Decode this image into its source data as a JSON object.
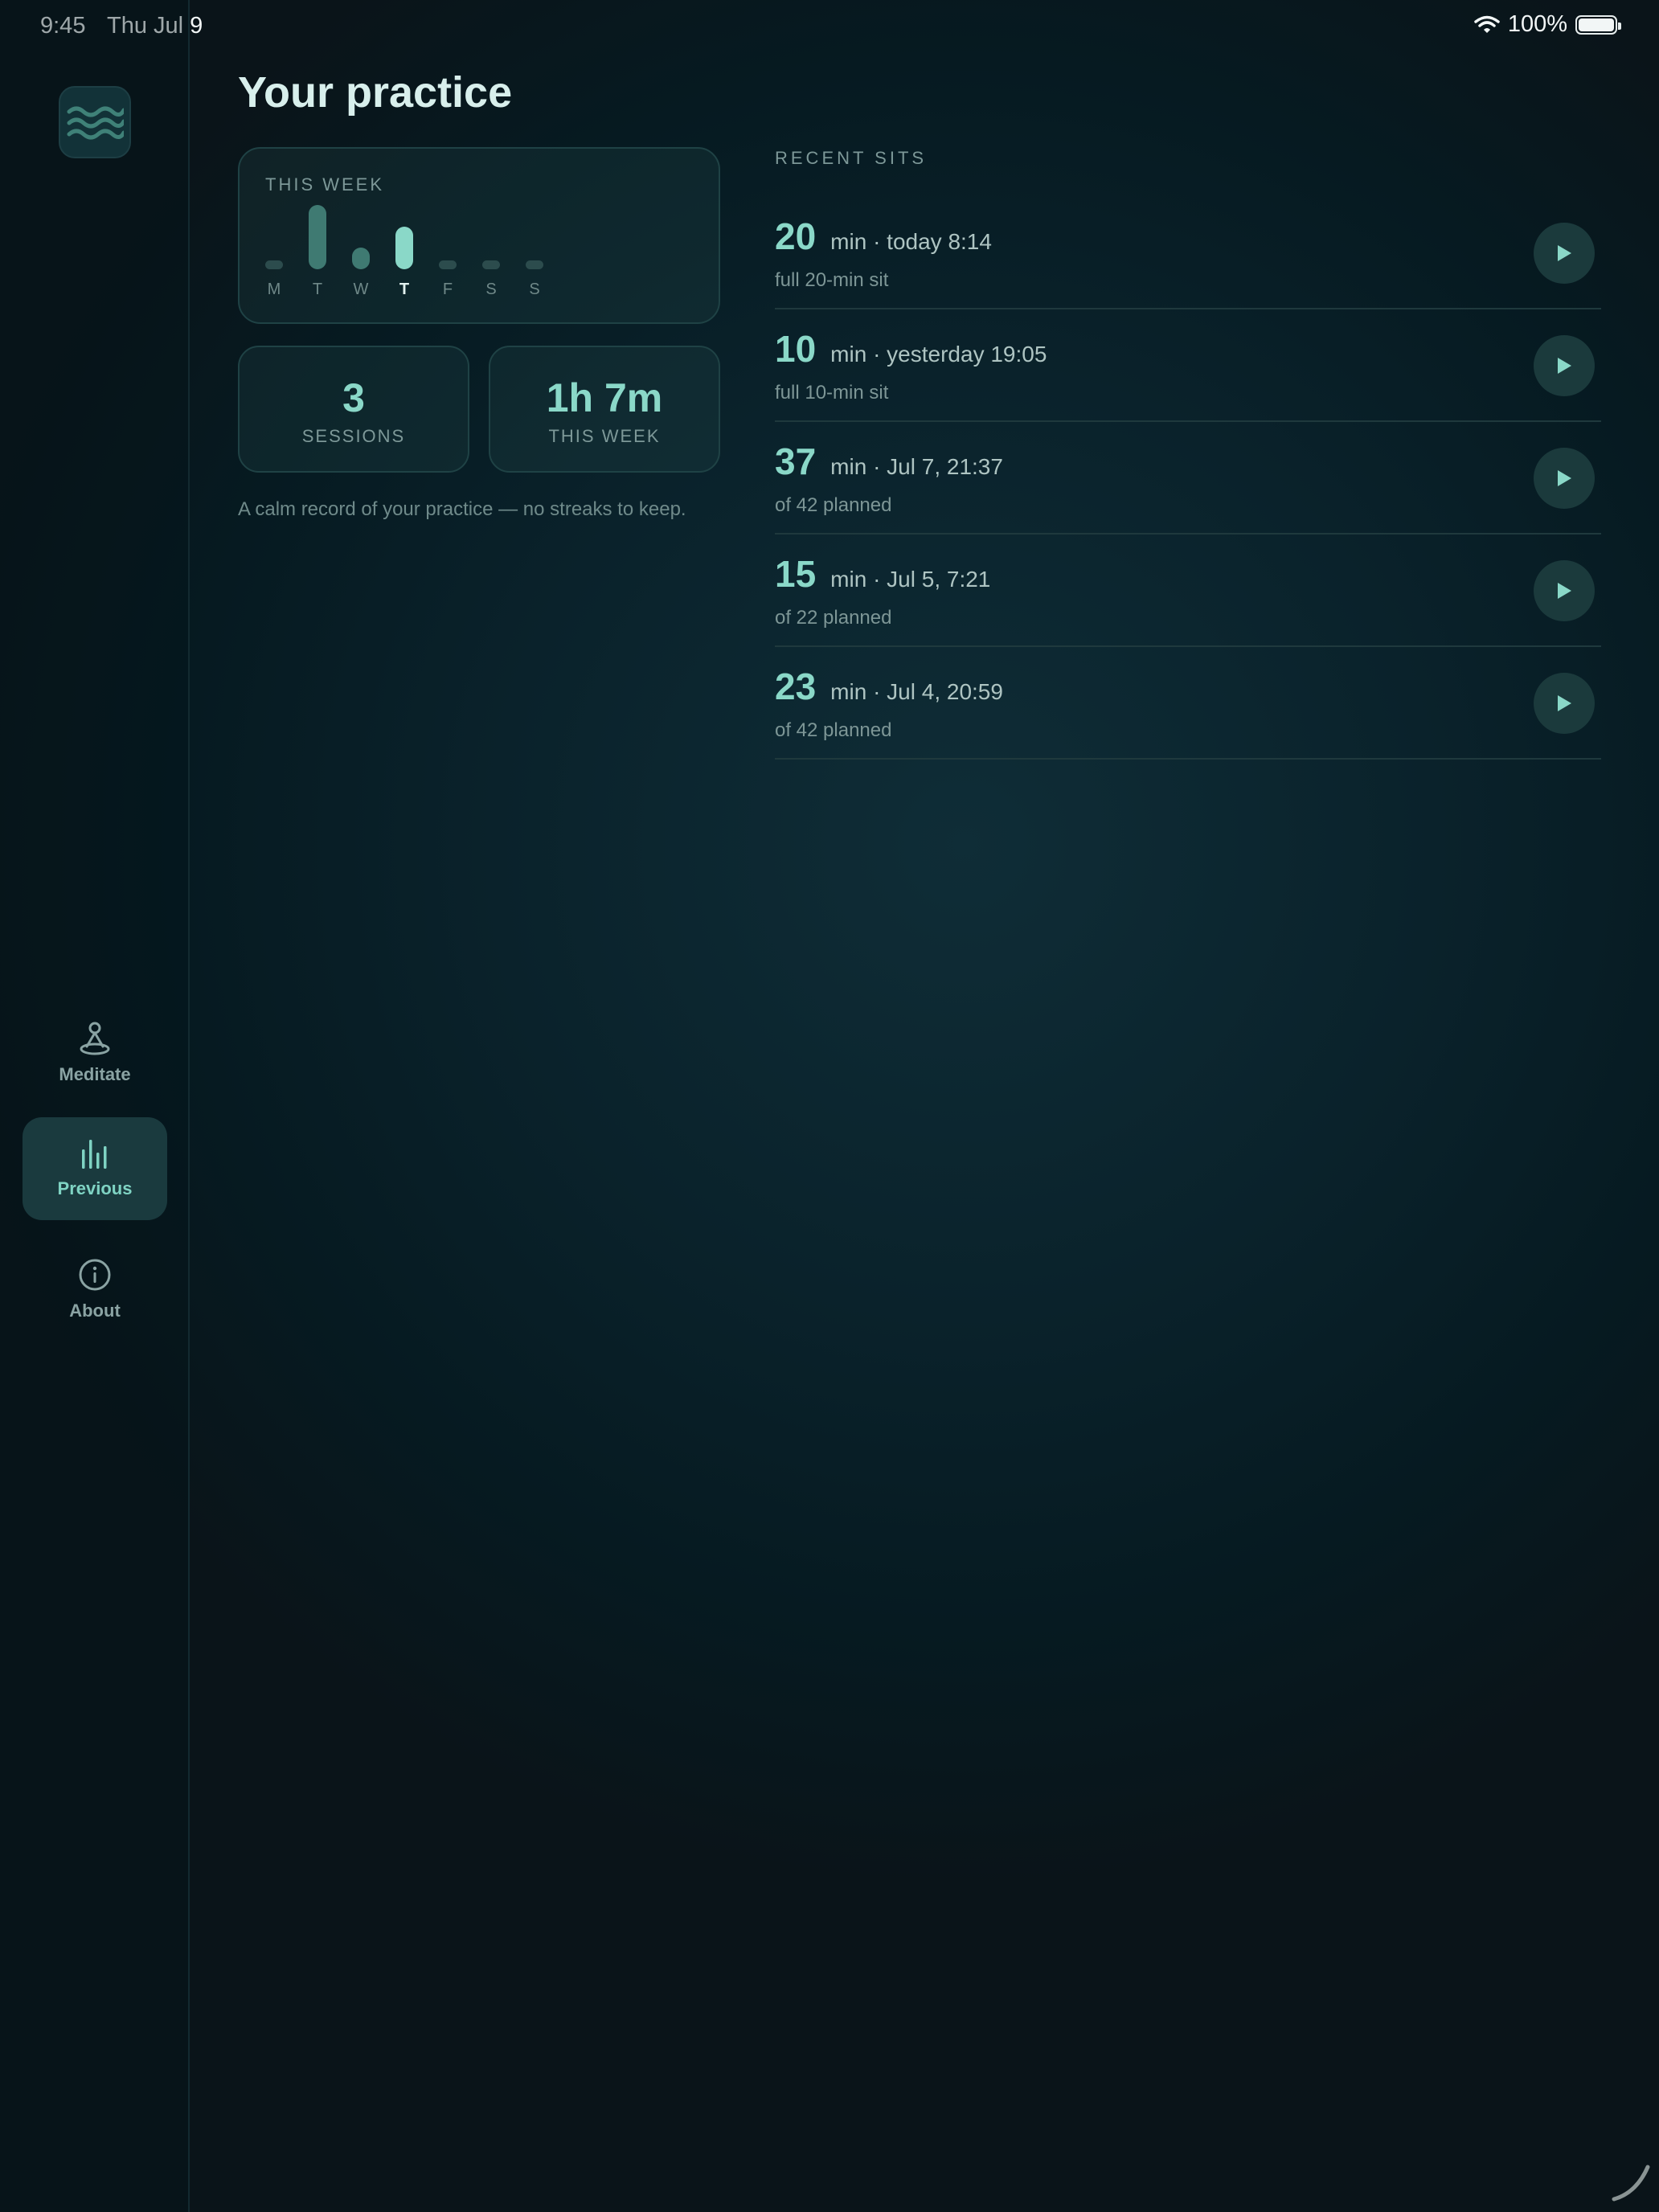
{
  "status_bar": {
    "time": "9:45",
    "date": "Thu Jul 9",
    "battery": "100%"
  },
  "sidebar": {
    "items": [
      {
        "label": "Meditate",
        "icon": "meditate-icon",
        "active": false
      },
      {
        "label": "Previous",
        "icon": "bars-icon",
        "active": true
      },
      {
        "label": "About",
        "icon": "info-icon",
        "active": false
      }
    ]
  },
  "page": {
    "title": "Your practice"
  },
  "week": {
    "label": "THIS WEEK",
    "days": [
      {
        "day": "M",
        "minutes": 0,
        "today": false
      },
      {
        "day": "T",
        "minutes": 30,
        "today": false
      },
      {
        "day": "W",
        "minutes": 10,
        "today": false
      },
      {
        "day": "T",
        "minutes": 20,
        "today": true
      },
      {
        "day": "F",
        "minutes": 0,
        "today": false
      },
      {
        "day": "S",
        "minutes": 0,
        "today": false
      },
      {
        "day": "S",
        "minutes": 0,
        "today": false
      }
    ]
  },
  "stats": {
    "sessions_value": "3",
    "sessions_label": "SESSIONS",
    "week_value": "1h 7m",
    "week_label": "THIS WEEK"
  },
  "note": "A calm record of your practice — no streaks to keep.",
  "recent": {
    "label": "RECENT SITS",
    "items": [
      {
        "minutes": "20",
        "meta": "min · today 8:14",
        "sub": "full 20-min sit"
      },
      {
        "minutes": "10",
        "meta": "min · yesterday 19:05",
        "sub": "full 10-min sit"
      },
      {
        "minutes": "37",
        "meta": "min · Jul 7, 21:37",
        "sub": "of 42 planned"
      },
      {
        "minutes": "15",
        "meta": "min · Jul 5, 7:21",
        "sub": "of 22 planned"
      },
      {
        "minutes": "23",
        "meta": "min · Jul 4, 20:59",
        "sub": "of 42 planned"
      }
    ]
  },
  "colors": {
    "accent": "#8ad8c8",
    "background": "#0a222b"
  }
}
